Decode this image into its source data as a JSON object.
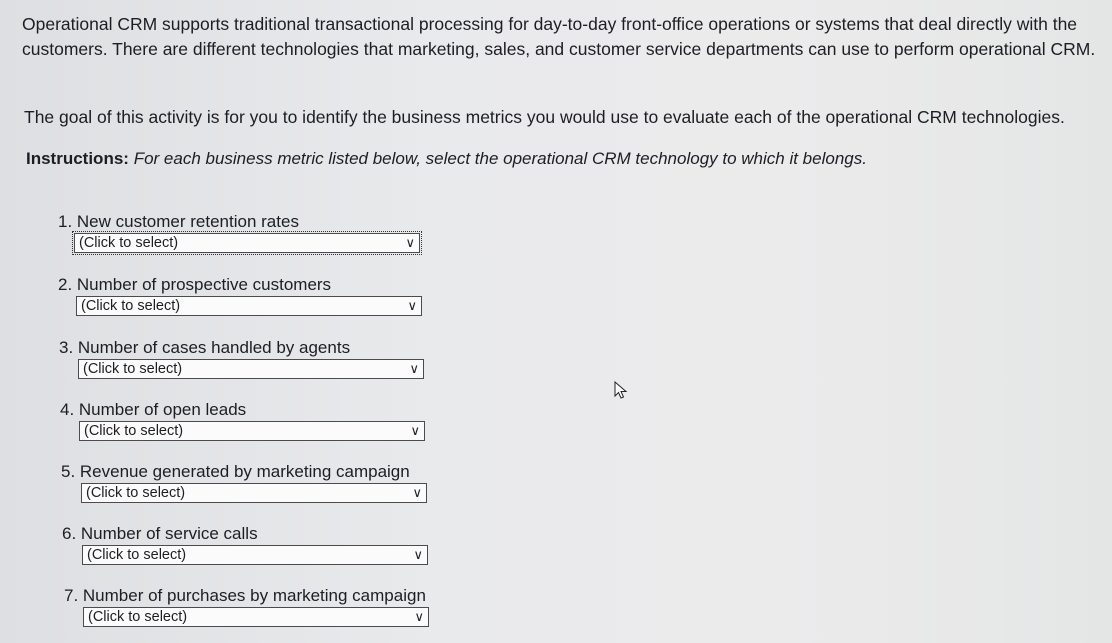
{
  "intro": "Operational CRM supports traditional transactional processing for day-to-day front-office operations or systems that deal directly with the customers. There are different technologies that marketing, sales, and customer service departments can use to perform operational CRM.",
  "goal": "The goal of this activity is for you to identify the business metrics you would use to evaluate each of the operational CRM technologies.",
  "instructions": {
    "label": "Instructions:",
    "text": "For each business metric listed below, select the operational CRM technology to which it belongs."
  },
  "questions": [
    {
      "label": "1. New customer retention rates",
      "selected": "(Click to select)"
    },
    {
      "label": "2. Number of prospective customers",
      "selected": "(Click to select)"
    },
    {
      "label": "3. Number of cases handled by agents",
      "selected": "(Click to select)"
    },
    {
      "label": "4. Number of open leads",
      "selected": "(Click to select)"
    },
    {
      "label": "5. Revenue generated by marketing campaign",
      "selected": "(Click to select)"
    },
    {
      "label": "6. Number of service calls",
      "selected": "(Click to select)"
    },
    {
      "label": "7. Number of purchases by marketing campaign",
      "selected": "(Click to select)"
    }
  ],
  "icons": {
    "dropdown": "chevron-down-icon",
    "cursor": "mouse-pointer-icon"
  }
}
